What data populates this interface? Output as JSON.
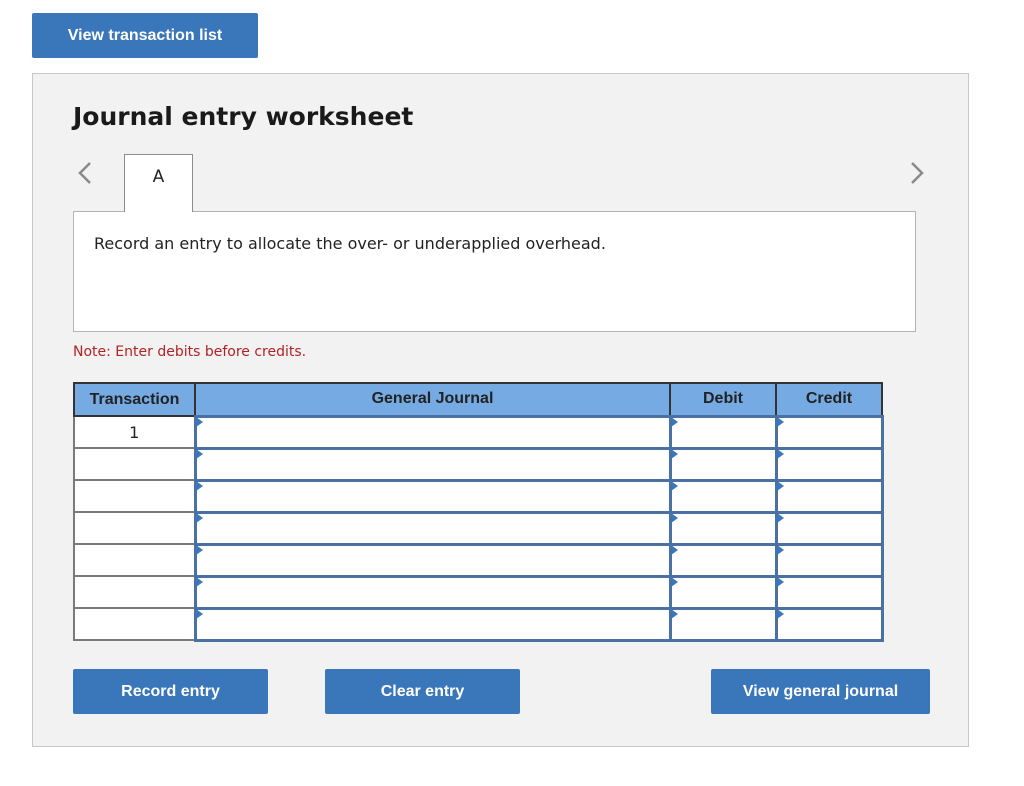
{
  "top": {
    "view_transaction_list_label": "View transaction list"
  },
  "worksheet": {
    "title": "Journal entry worksheet",
    "nav": {
      "prev_icon": "chevron-left-icon",
      "next_icon": "chevron-right-icon"
    },
    "tabs": [
      {
        "label": "A",
        "active": true
      }
    ],
    "description": "Record an entry to allocate the over- or underapplied overhead.",
    "note": "Note: Enter debits before credits.",
    "table": {
      "headers": [
        "Transaction",
        "General Journal",
        "Debit",
        "Credit"
      ],
      "rows": [
        {
          "transaction": "1",
          "account": "",
          "debit": "",
          "credit": ""
        },
        {
          "transaction": "",
          "account": "",
          "debit": "",
          "credit": ""
        },
        {
          "transaction": "",
          "account": "",
          "debit": "",
          "credit": ""
        },
        {
          "transaction": "",
          "account": "",
          "debit": "",
          "credit": ""
        },
        {
          "transaction": "",
          "account": "",
          "debit": "",
          "credit": ""
        },
        {
          "transaction": "",
          "account": "",
          "debit": "",
          "credit": ""
        },
        {
          "transaction": "",
          "account": "",
          "debit": "",
          "credit": ""
        }
      ]
    },
    "buttons": {
      "record_entry": "Record entry",
      "clear_entry": "Clear entry",
      "view_general_journal": "View general journal"
    }
  },
  "colors": {
    "button_blue": "#3a76ba",
    "header_blue": "#75aae3",
    "note_red": "#b22222",
    "panel_bg": "#f2f2f2"
  }
}
